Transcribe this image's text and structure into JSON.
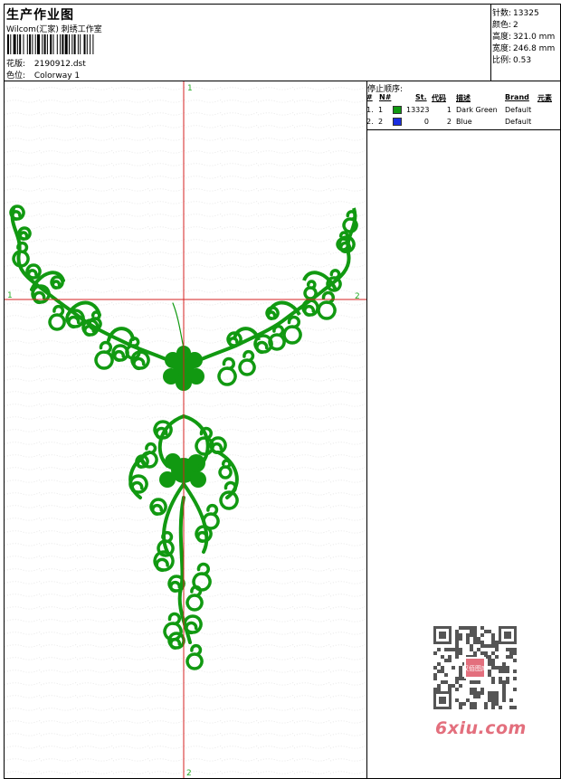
{
  "header": {
    "title": "生产作业图",
    "company": "Wilcom(汇家) 刺绣工作室",
    "file_label": "花版:",
    "file_value": "2190912.dst",
    "colorway_label": "色位:",
    "colorway_value": "Colorway 1"
  },
  "stats": {
    "stitches_label": "针数:",
    "stitches_value": "13325",
    "colors_label": "颜色:",
    "colors_value": "2",
    "height_label": "高度:",
    "height_value": "321.0 mm",
    "width_label": "宽度:",
    "width_value": "246.8 mm",
    "scale_label": "比例:",
    "scale_value": "0.53"
  },
  "stop_sequence": {
    "title": "停止顺序:",
    "columns": [
      "#",
      "N#",
      "St.",
      "代码",
      "描述",
      "Brand",
      "元素"
    ],
    "rows": [
      {
        "idx": "1.",
        "n": "1",
        "color": "#119911",
        "stitches": "13323",
        "code": "1",
        "desc": "Dark Green",
        "brand": "Default"
      },
      {
        "idx": "2.",
        "n": "2",
        "color": "#1a2ee0",
        "stitches": "0",
        "code": "2",
        "desc": "Blue",
        "brand": "Default"
      }
    ]
  },
  "design": {
    "thread_color": "#119911",
    "crosshair_color": "#d42020",
    "marker_color": "#22aa22",
    "markers": {
      "top": "1",
      "left": "1",
      "right": "2",
      "bottom": "2"
    }
  },
  "watermark": {
    "text": "6xiu.com",
    "stamp_text": "汉佰图库"
  }
}
